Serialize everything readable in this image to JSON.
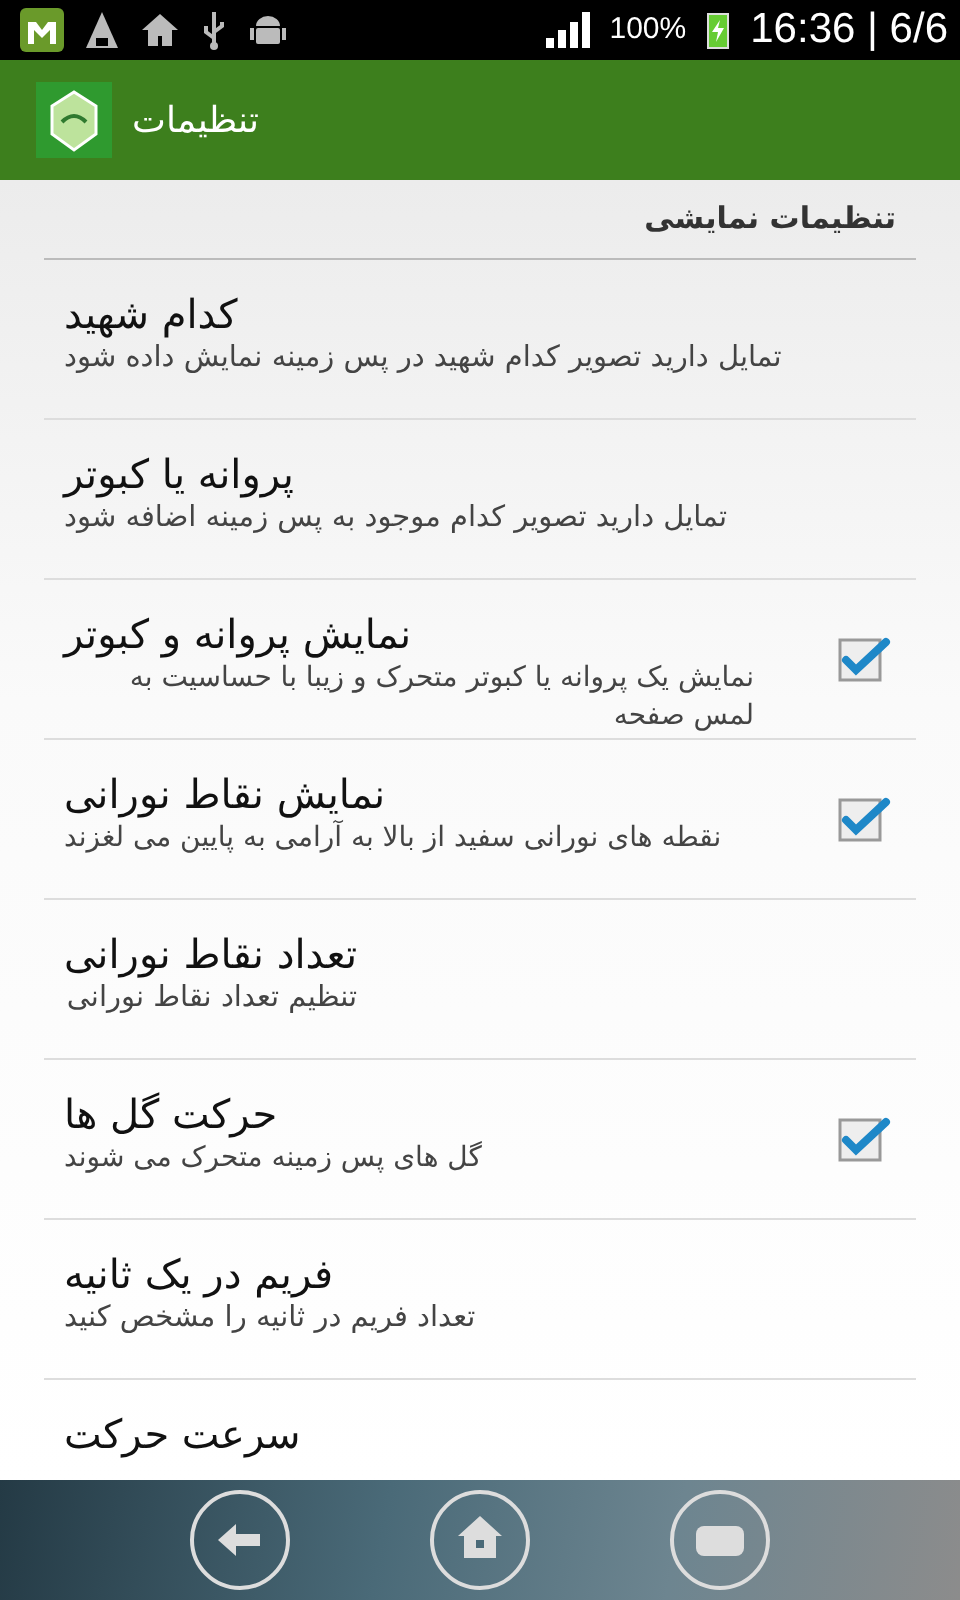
{
  "status_bar": {
    "battery": "100%",
    "time": "16:36 | 6/6"
  },
  "app_bar": {
    "title": "تنظیمات"
  },
  "category": "تنظیمات نمایشی",
  "preferences": [
    {
      "kind": "plain",
      "title": "کدام شهید",
      "summary": "تمایل دارید تصویر کدام شهید در پس زمینه نمایش داده شود"
    },
    {
      "kind": "plain",
      "title": "پروانه یا کبوتر",
      "summary": "تمایل دارید تصویر کدام موجود به پس زمینه اضافه شود"
    },
    {
      "kind": "checkbox",
      "title": "نمایش پروانه و کبوتر",
      "summary": "نمایش یک پروانه یا کبوتر متحرک و زیبا با حساسیت به لمس صفحه",
      "checked": true
    },
    {
      "kind": "checkbox",
      "title": "نمایش نقاط نورانی",
      "summary": "نقطه های نورانی سفید از بالا به آرامی به پایین می لغزند",
      "checked": true
    },
    {
      "kind": "plain",
      "title": "تعداد نقاط نورانی",
      "summary": "تنظیم تعداد نقاط نورانی"
    },
    {
      "kind": "checkbox",
      "title": "حرکت گل ها",
      "summary": "گل های پس زمینه متحرک می شوند",
      "checked": true
    },
    {
      "kind": "plain",
      "title": "فریم در یک ثانیه",
      "summary": "تعداد فریم در ثانیه را مشخص کنید"
    },
    {
      "kind": "plain",
      "title": "سرعت حرکت"
    }
  ]
}
